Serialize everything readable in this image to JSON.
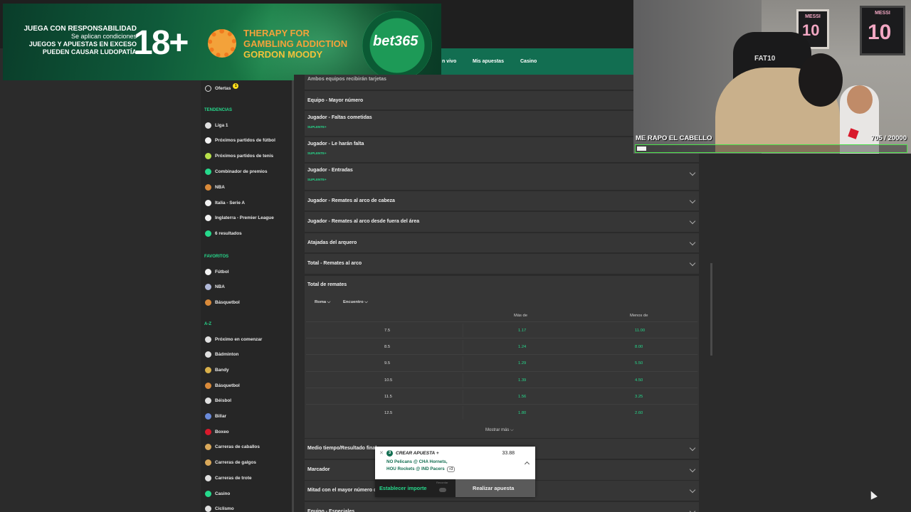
{
  "ad": {
    "resp_line1": "JUEGA CON RESPONSABILIDAD",
    "resp_line2": "Se aplican condiciones",
    "resp_line3": "JUEGOS Y APUESTAS EN EXCESO",
    "resp_line4": "PUEDEN CAUSAR LUDOPATÍA",
    "age": "18+",
    "therapy_line1": "THERAPY FOR",
    "therapy_line2": "GAMBLING ADDICTION",
    "gordon": "GORDON MOODY",
    "brand": "bet365"
  },
  "nav": {
    "items": [
      "n vivo",
      "Mis apuestas",
      "Casino"
    ]
  },
  "sidebar": {
    "offers_label": "Ofertas",
    "offers_badge": "1",
    "trends_heading": "TENDENCIAS",
    "trends": [
      {
        "label": "Liga 1",
        "icon": "peru-flag-icon",
        "color": "#e0e0e0"
      },
      {
        "label": "Próximos partidos de fútbol",
        "icon": "soccer-ball-icon",
        "color": "#f2f2f2"
      },
      {
        "label": "Próximos partidos de tenis",
        "icon": "tennis-ball-icon",
        "color": "#b8e04a"
      },
      {
        "label": "Combinador de premios",
        "icon": "builder-icon",
        "color": "#26d98c"
      },
      {
        "label": "NBA",
        "icon": "basketball-icon",
        "color": "#d98a3a"
      },
      {
        "label": "Italia - Serie A",
        "icon": "soccer-ball-icon",
        "color": "#f2f2f2"
      },
      {
        "label": "Inglaterra - Premier League",
        "icon": "soccer-ball-icon",
        "color": "#f2f2f2"
      },
      {
        "label": "6 resultados",
        "icon": "results-icon",
        "color": "#26d98c"
      }
    ],
    "fav_heading": "FAVORITOS",
    "favorites": [
      {
        "label": "Fútbol",
        "icon": "soccer-ball-icon",
        "color": "#f2f2f2"
      },
      {
        "label": "NBA",
        "icon": "usa-flag-icon",
        "color": "#b0b8d8"
      },
      {
        "label": "Básquetbol",
        "icon": "basketball-icon",
        "color": "#d98a3a"
      }
    ],
    "az_heading": "A-Z",
    "az": [
      {
        "label": "Próximo en comenzar",
        "icon": "arrows-icon",
        "color": "#e0e0e0"
      },
      {
        "label": "Bádminton",
        "icon": "shuttlecock-icon",
        "color": "#e0e0e0"
      },
      {
        "label": "Bandy",
        "icon": "bandy-stick-icon",
        "color": "#d9b04a"
      },
      {
        "label": "Básquetbol",
        "icon": "basketball-icon",
        "color": "#d98a3a"
      },
      {
        "label": "Béisbol",
        "icon": "baseball-icon",
        "color": "#e0e0e0"
      },
      {
        "label": "Billar",
        "icon": "billiards-icon",
        "color": "#6a8ad9"
      },
      {
        "label": "Boxeo",
        "icon": "boxing-glove-icon",
        "color": "#d9192b"
      },
      {
        "label": "Carreras de caballos",
        "icon": "horse-icon",
        "color": "#d9a85a"
      },
      {
        "label": "Carreras de galgos",
        "icon": "greyhound-icon",
        "color": "#d9a85a"
      },
      {
        "label": "Carreras de trote",
        "icon": "trotting-icon",
        "color": "#e0e0e0"
      },
      {
        "label": "Casino",
        "icon": "casino-icon",
        "color": "#26d98c"
      },
      {
        "label": "Ciclismo",
        "icon": "bicycle-icon",
        "color": "#e0e0e0"
      }
    ]
  },
  "markets": {
    "partial_top": "Ambos equipos recibirán tarjetas",
    "list": [
      {
        "title": "Equipo - Mayor número",
        "sub": ""
      },
      {
        "title": "Jugador - Faltas cometidas",
        "sub": "SUPLENTE+"
      },
      {
        "title": "Jugador - Le harán falta",
        "sub": "SUPLENTE+"
      },
      {
        "title": "Jugador - Entradas",
        "sub": "SUPLENTE+"
      },
      {
        "title": "Jugador - Remates al arco de cabeza",
        "sub": ""
      },
      {
        "title": "Jugador - Remates al arco desde fuera del área",
        "sub": ""
      },
      {
        "title": "Atajadas del arquero",
        "sub": ""
      },
      {
        "title": "Total - Remates al arco",
        "sub": ""
      }
    ],
    "expanded": {
      "title": "Total de remates",
      "filter1": "Roma",
      "filter2": "Encuentro",
      "col_over": "Más de",
      "col_under": "Menos de",
      "rows": [
        {
          "line": "7.5",
          "over": "1.17",
          "under": "11.00"
        },
        {
          "line": "8.5",
          "over": "1.24",
          "under": "8.00"
        },
        {
          "line": "9.5",
          "over": "1.29",
          "under": "5.50"
        },
        {
          "line": "10.5",
          "over": "1.39",
          "under": "4.50"
        },
        {
          "line": "11.5",
          "over": "1.56",
          "under": "3.25"
        },
        {
          "line": "12.5",
          "over": "1.80",
          "under": "2.60"
        }
      ],
      "more": "Mostrar más"
    },
    "bottom": [
      {
        "title": "Medio tiempo/Resultado final"
      },
      {
        "title": "Marcador"
      },
      {
        "title": "Mitad con el mayor número de goles"
      },
      {
        "title": "Equipo - Especiales"
      }
    ]
  },
  "slip": {
    "count": "3",
    "create": "CREAR APUESTA +",
    "odds": "33.88",
    "game1": "NO Pelicans @ CHA Hornets,",
    "game2": "HOU Rockets @ IND Pacers",
    "extra": "+3",
    "stake_label": "Establecer importe",
    "remember": "Recordar",
    "place_label": "Realizar apuesta"
  },
  "cam": {
    "goal_text": "ME RAPO EL CABELLO",
    "goal_count": "705  / 20000",
    "progress": 0.035,
    "frame1_name": "MESSI",
    "frame1_num": "10",
    "frame2_name": "MESSI",
    "frame2_num": "10",
    "chair_text": "FAT10"
  }
}
